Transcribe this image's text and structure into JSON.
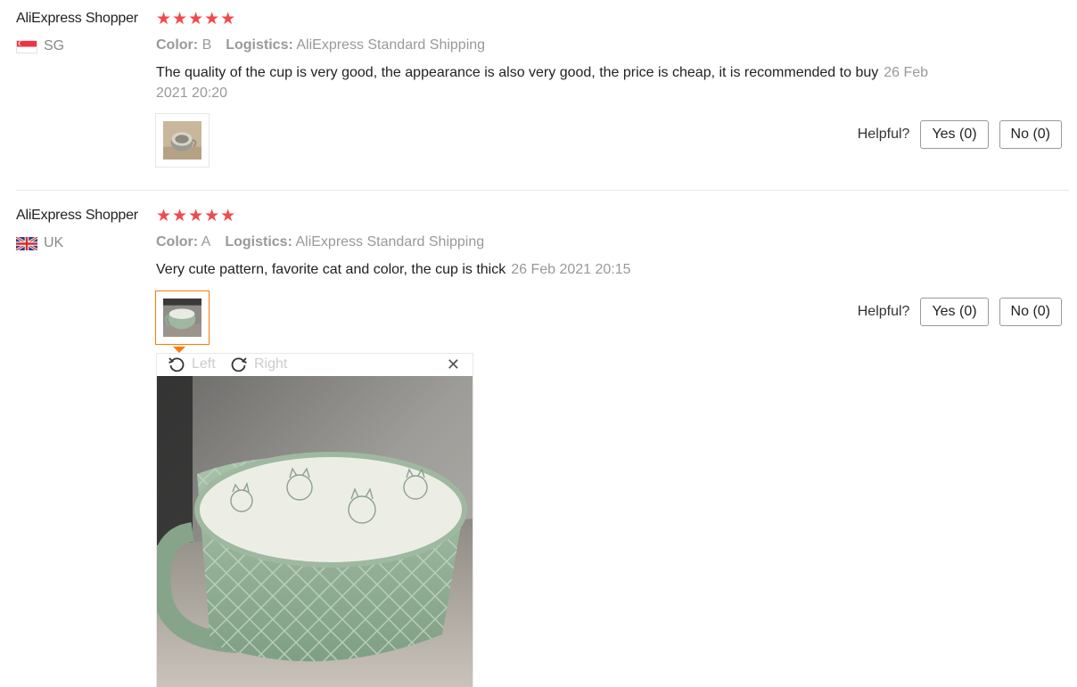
{
  "reviews": [
    {
      "user": "AliExpress Shopper",
      "stars": "★★★★★",
      "country_code": "SG",
      "flag_icon": "singapore-flag-icon",
      "color_label": "Color:",
      "color_value": "B",
      "logistics_label": "Logistics:",
      "logistics_value": "AliExpress Standard Shipping",
      "text": "The quality of the cup is very good, the appearance is also very good, the price is cheap, it is recommended to buy",
      "date": "26 Feb 2021 20:20",
      "helpful_label": "Helpful?",
      "yes_label": "Yes (0)",
      "no_label": "No (0)"
    },
    {
      "user": "AliExpress Shopper",
      "stars": "★★★★★",
      "country_code": "UK",
      "flag_icon": "uk-flag-icon",
      "color_label": "Color:",
      "color_value": "A",
      "logistics_label": "Logistics:",
      "logistics_value": "AliExpress Standard Shipping",
      "text": "Very cute pattern, favorite cat and color, the cup is thick",
      "date": "26 Feb 2021 20:15",
      "helpful_label": "Helpful?",
      "yes_label": "Yes (0)",
      "no_label": "No (0)"
    }
  ],
  "viewer": {
    "rotate_left_label": "Left",
    "rotate_right_label": "Right",
    "close_glyph": "✕"
  },
  "colors": {
    "star": "#f0494d",
    "accent": "#ff7a00",
    "muted": "#999999"
  }
}
